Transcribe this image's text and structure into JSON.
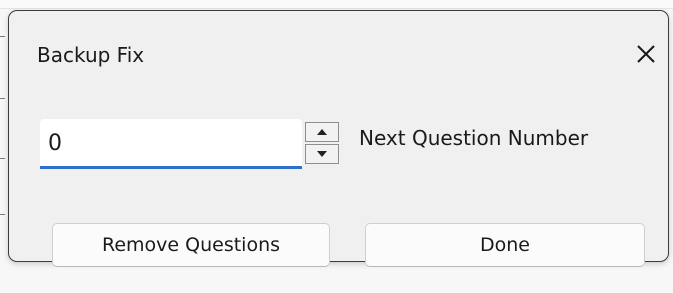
{
  "dialog": {
    "title": "Backup Fix",
    "close_icon": "close-icon"
  },
  "spinbox": {
    "value": "0",
    "up_icon": "triangle-up-icon",
    "down_icon": "triangle-down-icon",
    "label": "Next Question Number"
  },
  "buttons": {
    "remove_label": "Remove Questions",
    "done_label": "Done"
  },
  "colors": {
    "focus_underline": "#2d6fc9",
    "dialog_background": "#f0f0f0"
  }
}
